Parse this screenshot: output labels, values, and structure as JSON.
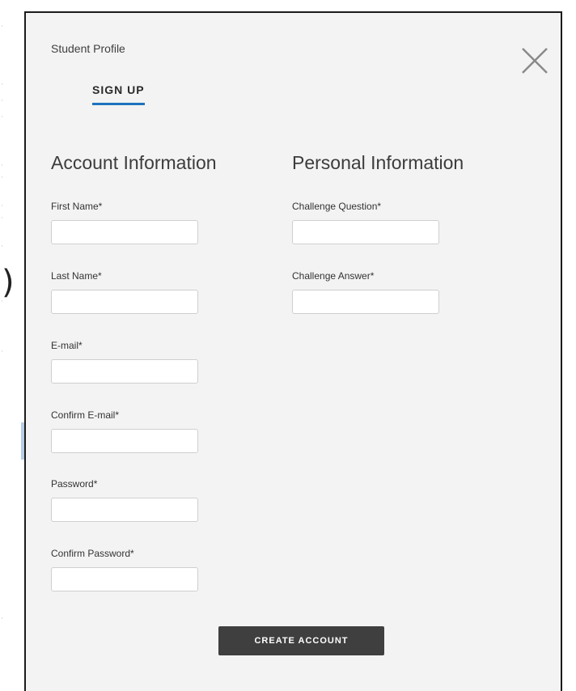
{
  "modal": {
    "title": "Student Profile",
    "close_icon": "close-icon"
  },
  "tabs": [
    {
      "label": "SIGN UP",
      "active": true
    }
  ],
  "account_section": {
    "heading": "Account Information",
    "fields": [
      {
        "label": "First Name*",
        "value": ""
      },
      {
        "label": "Last Name*",
        "value": ""
      },
      {
        "label": "E-mail*",
        "value": ""
      },
      {
        "label": "Confirm E-mail*",
        "value": ""
      },
      {
        "label": "Password*",
        "value": ""
      },
      {
        "label": "Confirm Password*",
        "value": ""
      }
    ]
  },
  "personal_section": {
    "heading": "Personal Information",
    "fields": [
      {
        "label": "Challenge Question*",
        "value": ""
      },
      {
        "label": "Challenge Answer*",
        "value": ""
      }
    ]
  },
  "actions": {
    "create_account_label": "CREATE ACCOUNT"
  },
  "colors": {
    "modal_background": "#f3f3f3",
    "tab_underline": "#1e73be",
    "button_background": "#3f3f3f"
  }
}
